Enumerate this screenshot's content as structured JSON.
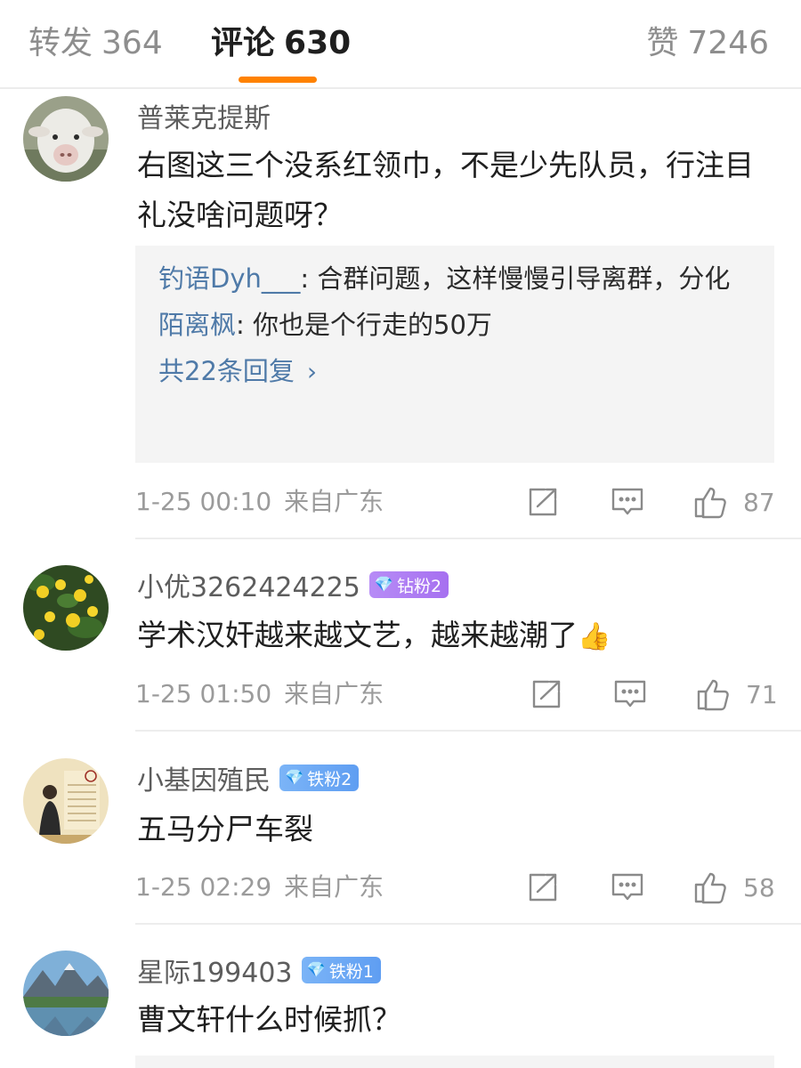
{
  "tabs": {
    "reposts": {
      "label": "转发",
      "count": "364"
    },
    "comments": {
      "label": "评论",
      "count": "630"
    },
    "likes": {
      "label": "赞",
      "count": "7246"
    }
  },
  "accent_color": "#ff8200",
  "link_color": "#4f7aa8",
  "comments": [
    {
      "username": "普莱克提斯",
      "avatar": "sheep-avatar",
      "content": "右图这三个没系红领巾，不是少先队员，行注目礼没啥问题呀？",
      "replies": [
        {
          "user": "钓语Dyh___",
          "sep": ": ",
          "text": "合群问题，这样慢慢引导离群，分化"
        },
        {
          "user": "陌离枫",
          "sep": ": ",
          "text": "你也是个行走的50万"
        }
      ],
      "more_replies": "共22条回复",
      "time": "1-25 00:10",
      "source": "来自广东",
      "likes": "87"
    },
    {
      "username": "小优3262424225",
      "badge": "钻粉2",
      "avatar": "flowers-avatar",
      "content": "学术汉奸越来越文艺，越来越潮了",
      "emoji": "👍",
      "time": "1-25 01:50",
      "source": "来自广东",
      "likes": "71"
    },
    {
      "username": "小基因殖民",
      "badge": "铁粉2",
      "avatar": "scroll-avatar",
      "content": "五马分尸车裂",
      "time": "1-25 02:29",
      "source": "来自广东",
      "likes": "58"
    },
    {
      "username": "星际199403",
      "badge": "铁粉1",
      "avatar": "mountain-lake-avatar",
      "content": "曹文轩什么时候抓？"
    }
  ]
}
